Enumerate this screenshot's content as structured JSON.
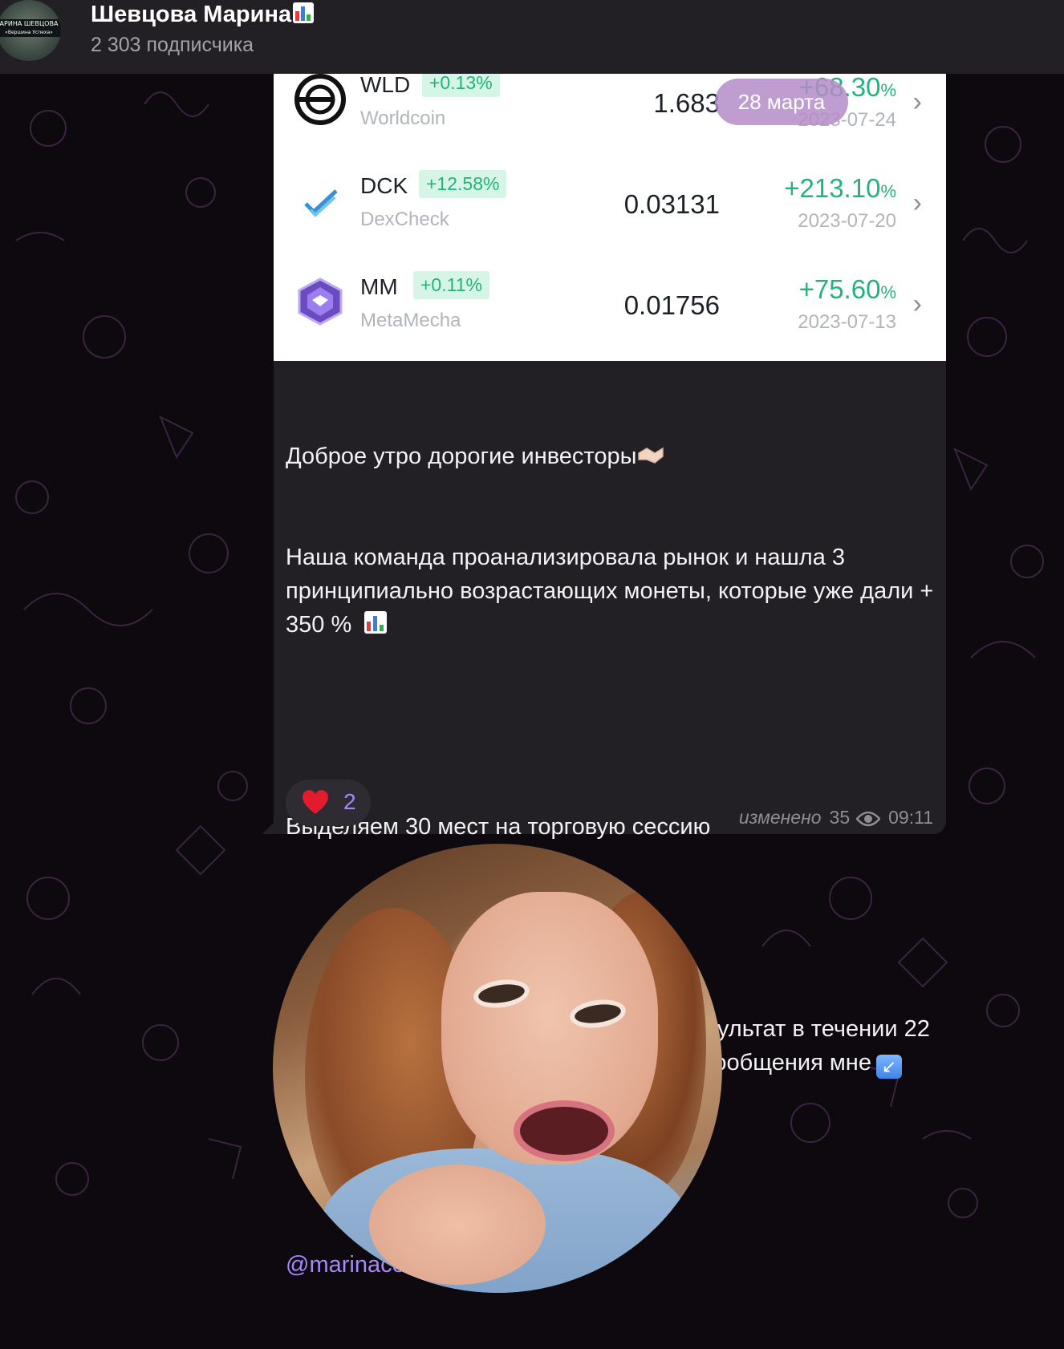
{
  "header": {
    "avatar": {
      "line1": "АРИНА ШЕВЦОВА",
      "line2": "«Вершина Успеха»"
    },
    "title": "Шевцова Марина",
    "subscribers": "2 303 подписчика"
  },
  "date_pill": "28 марта",
  "coins": [
    {
      "ticker": "WLD",
      "change": "+0.13%",
      "name": "Worldcoin",
      "price": "1.683",
      "gain": "+68.30",
      "gain_unit": "%",
      "date": "2023-07-24"
    },
    {
      "ticker": "DCK",
      "change": "+12.58%",
      "name": "DexCheck",
      "price": "0.03131",
      "gain": "+213.10",
      "gain_unit": "%",
      "date": "2023-07-20"
    },
    {
      "ticker": "MM",
      "change": "+0.11%",
      "name": "MetaMecha",
      "price": "0.01756",
      "gain": "+75.60",
      "gain_unit": "%",
      "date": "2023-07-13"
    }
  ],
  "message": {
    "line1": "Доброе утро дорогие инвесторы",
    "line2": "Наша команда проанализировала рынок и нашла 3 принципиально возрастающих монеты, которые уже дали + 350 % ",
    "line3": "Выделяем 30 мест на торговую сессию",
    "line4": "Кто готов инвестировать и получить результат в течении 22 часов - пишите «ГОТОВ(А)» в личные сообщения мне",
    "mention": "@marinacorporation"
  },
  "reaction": {
    "emoji": "heart",
    "count": "2"
  },
  "meta": {
    "edited": "изменено",
    "views": "35",
    "time": "09:11"
  },
  "colors": {
    "accent": "#a886ff",
    "gain_green": "#22b37a",
    "bubble": "#222024"
  }
}
